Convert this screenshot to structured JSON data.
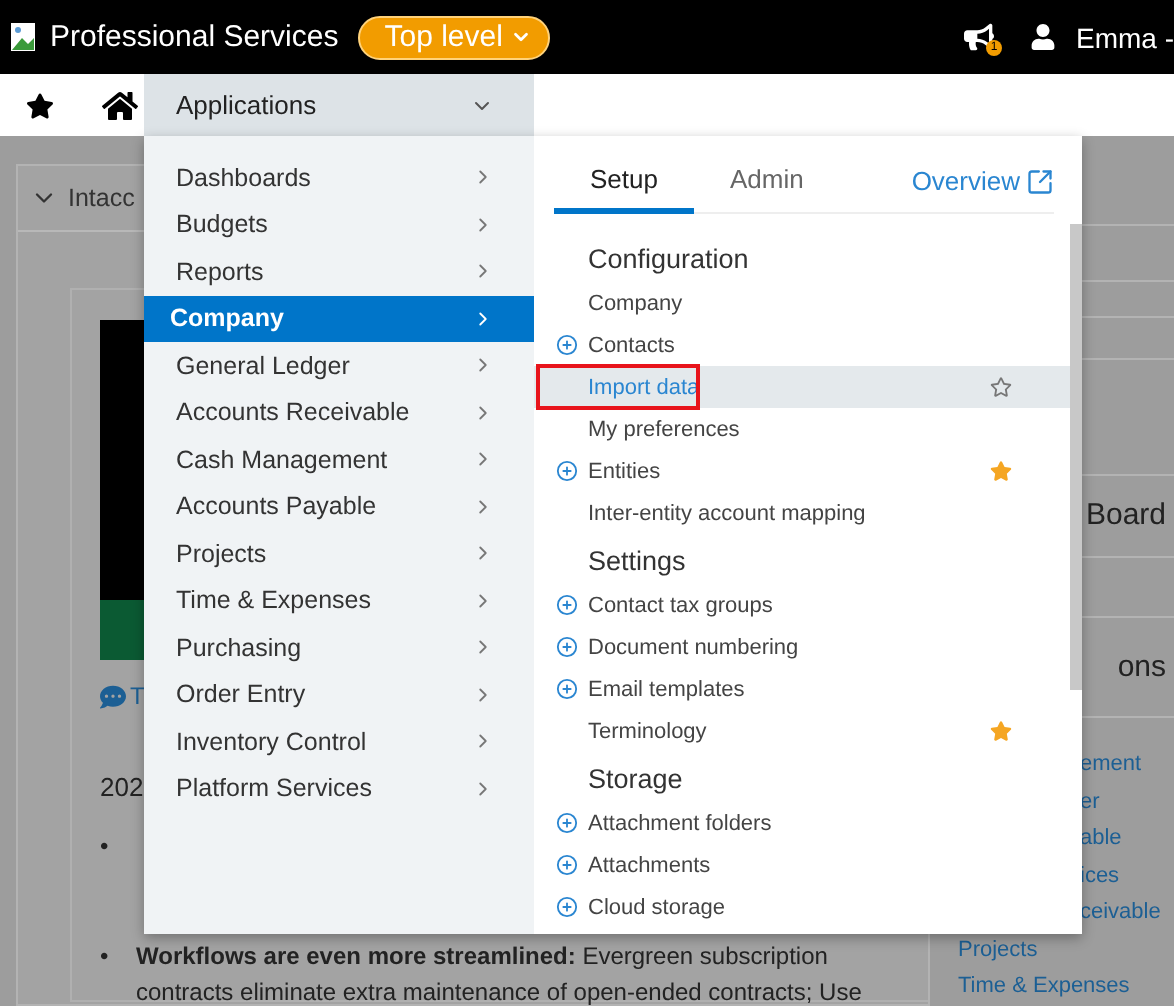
{
  "header": {
    "brand": "Professional Services",
    "level_button": "Top level",
    "notification_count": "1",
    "user": "Emma -"
  },
  "nav": {
    "applications": "Applications"
  },
  "background": {
    "card_title": "Intacc",
    "chat_link": "T",
    "year": "202",
    "bullets": [
      {
        "marker": "•"
      },
      {
        "marker": "•",
        "lines": [
          "**Workflows are even more streamlined:** Evergreen subscription",
          "contracts eliminate extra maintenance of open-ended contracts; Use"
        ]
      }
    ],
    "side_headings": [
      "Board",
      "ons"
    ],
    "side_links_beside_menu": [
      "ement",
      "er",
      "able",
      "ices",
      "ceivable"
    ],
    "side_links_below_menu": [
      "Projects",
      "Time & Expenses"
    ]
  },
  "menu": {
    "categories": [
      {
        "label": "Dashboards",
        "selected": false
      },
      {
        "label": "Budgets",
        "selected": false
      },
      {
        "label": "Reports",
        "selected": false
      },
      {
        "label": "Company",
        "selected": true
      },
      {
        "label": "General Ledger",
        "selected": false
      },
      {
        "label": "Accounts Receivable",
        "selected": false
      },
      {
        "label": "Cash Management",
        "selected": false
      },
      {
        "label": "Accounts Payable",
        "selected": false
      },
      {
        "label": "Projects",
        "selected": false
      },
      {
        "label": "Time & Expenses",
        "selected": false
      },
      {
        "label": "Purchasing",
        "selected": false
      },
      {
        "label": "Order Entry",
        "selected": false
      },
      {
        "label": "Inventory Control",
        "selected": false
      },
      {
        "label": "Platform Services",
        "selected": false
      }
    ],
    "tabs": [
      {
        "label": "Setup",
        "selected": true
      },
      {
        "label": "Admin",
        "selected": false
      }
    ],
    "overview_link": "Overview",
    "sections": [
      {
        "title": "Configuration",
        "items": [
          {
            "label": "Company",
            "addable": false,
            "starred": false,
            "highlighted": false
          },
          {
            "label": "Contacts",
            "addable": true,
            "starred": false,
            "highlighted": false
          },
          {
            "label": "Import data",
            "addable": false,
            "starred": false,
            "highlighted": true
          },
          {
            "label": "My preferences",
            "addable": false,
            "starred": false,
            "highlighted": false
          },
          {
            "label": "Entities",
            "addable": true,
            "starred": true,
            "highlighted": false
          },
          {
            "label": "Inter-entity account mapping",
            "addable": false,
            "starred": false,
            "highlighted": false
          }
        ]
      },
      {
        "title": "Settings",
        "items": [
          {
            "label": "Contact tax groups",
            "addable": true,
            "starred": false,
            "highlighted": false
          },
          {
            "label": "Document numbering",
            "addable": true,
            "starred": false,
            "highlighted": false
          },
          {
            "label": "Email templates",
            "addable": true,
            "starred": false,
            "highlighted": false
          },
          {
            "label": "Terminology",
            "addable": false,
            "starred": true,
            "highlighted": false
          }
        ]
      },
      {
        "title": "Storage",
        "items": [
          {
            "label": "Attachment folders",
            "addable": true,
            "starred": false,
            "highlighted": false
          },
          {
            "label": "Attachments",
            "addable": true,
            "starred": false,
            "highlighted": false
          },
          {
            "label": "Cloud storage",
            "addable": true,
            "starred": false,
            "highlighted": false
          }
        ]
      }
    ]
  }
}
